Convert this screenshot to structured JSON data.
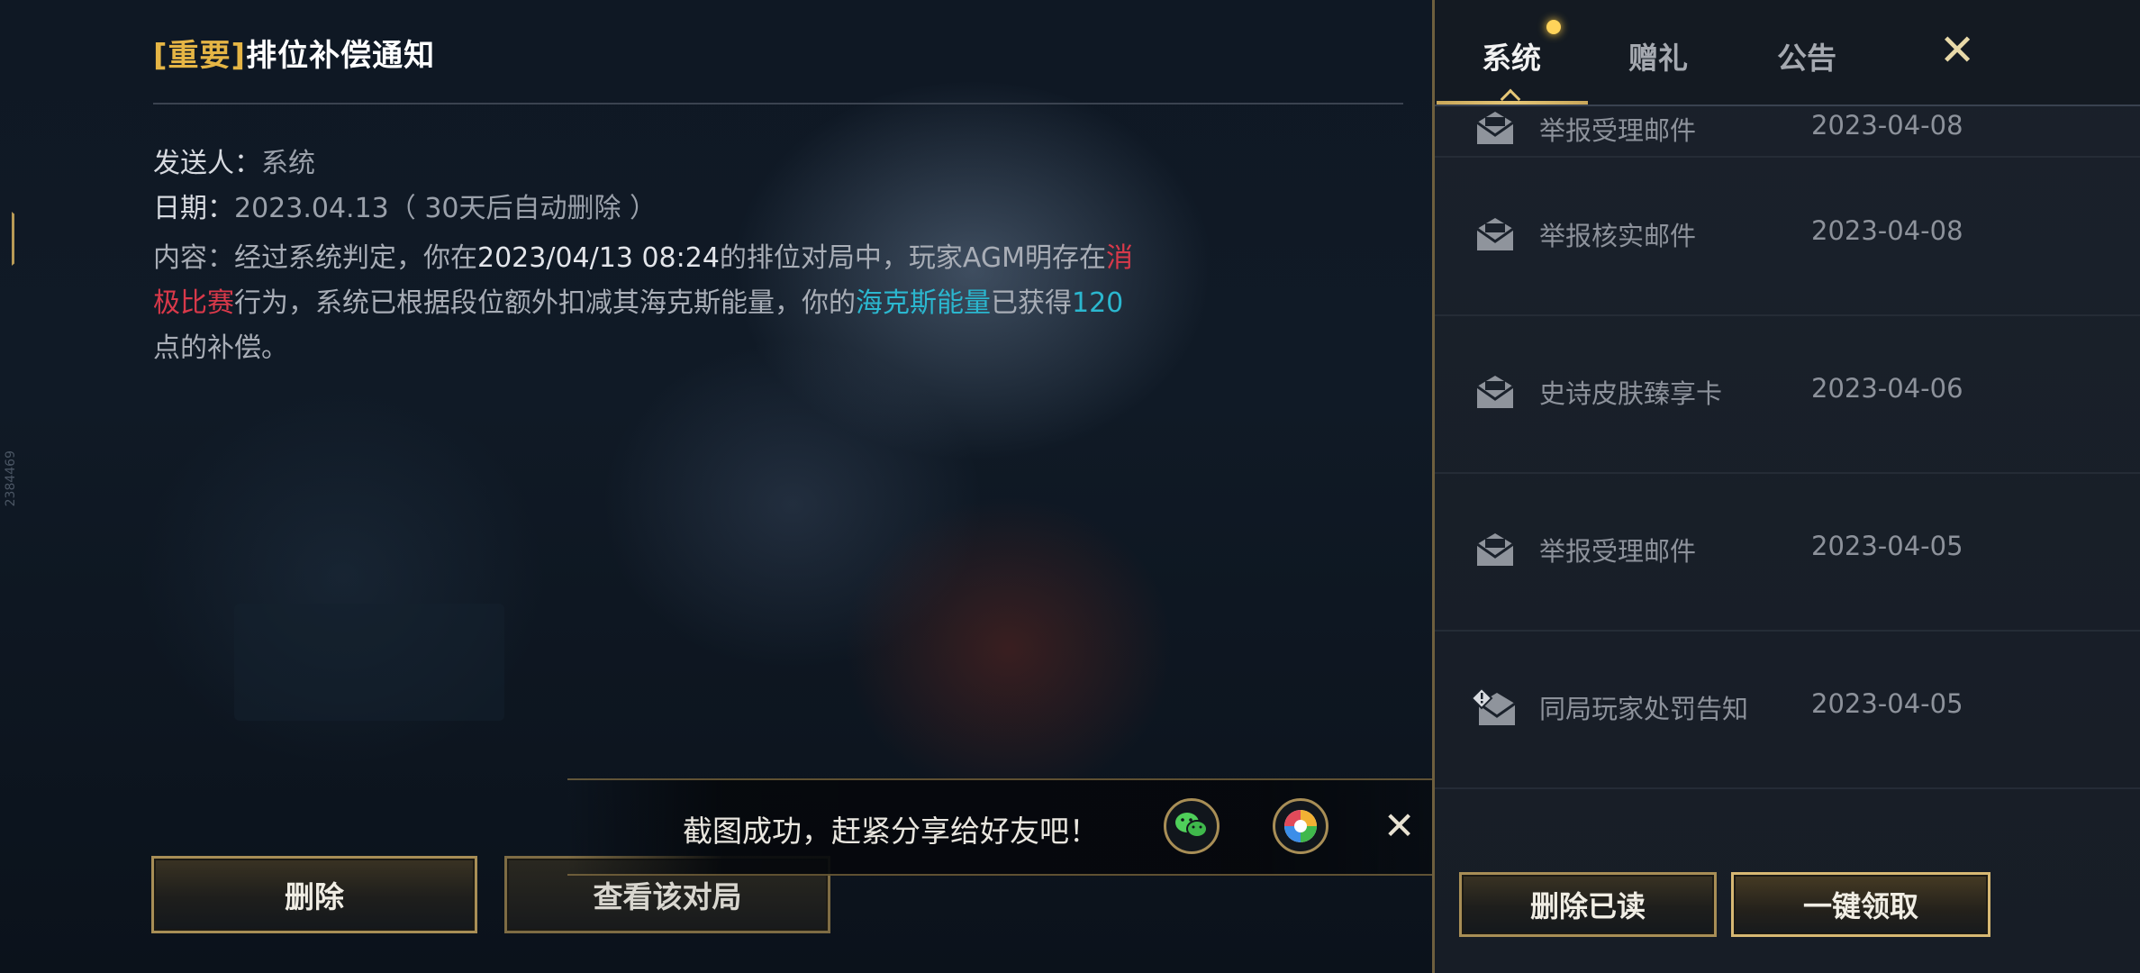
{
  "mail_detail": {
    "title_tag": "[重要]",
    "title": "排位补偿通知",
    "sender_label": "发送人：",
    "sender": "系统",
    "date_label": "日期：",
    "date": "2023.04.13",
    "auto_delete": "（ 30天后自动删除 ）",
    "content": {
      "p1": "内容：经过系统判定，你在",
      "datetime": "2023/04/13 08:24",
      "p2": "的排位对局中，玩家",
      "player": "AGM明存",
      "p3": "在",
      "violation": "消极比赛",
      "p4": "行为，系统已根据段位额外扣减其海克斯能量，你的",
      "currency": "海克斯能量",
      "p5": "已获得",
      "amount": "120",
      "p6": "点的补偿。"
    },
    "delete_button": "删除",
    "view_match_button": "查看该对局"
  },
  "toast": {
    "text": "截图成功，赶紧分享给好友吧！",
    "close": "✕"
  },
  "mailbox": {
    "tabs": [
      {
        "label": "系统",
        "active": true,
        "has_dot": true
      },
      {
        "label": "赠礼",
        "active": false
      },
      {
        "label": "公告",
        "active": false
      }
    ],
    "close": "✕",
    "mails": [
      {
        "subject": "举报受理邮件",
        "date": "2023-04-08",
        "icon": "mail-read-icon"
      },
      {
        "subject": "举报核实邮件",
        "date": "2023-04-08",
        "icon": "mail-read-icon"
      },
      {
        "subject": "史诗皮肤臻享卡",
        "date": "2023-04-06",
        "icon": "mail-read-icon"
      },
      {
        "subject": "举报受理邮件",
        "date": "2023-04-05",
        "icon": "mail-read-icon"
      },
      {
        "subject": "同局玩家处罚告知",
        "date": "2023-04-05",
        "icon": "mail-alert-icon"
      }
    ],
    "delete_read_button": "删除已读",
    "claim_all_button": "一键领取"
  },
  "side_number": "2384469",
  "colors": {
    "gold_accent": "#e5b545",
    "violation_red": "#d8394a",
    "highlight_cyan": "#2bb7cf",
    "button_border": "#a88e56"
  }
}
